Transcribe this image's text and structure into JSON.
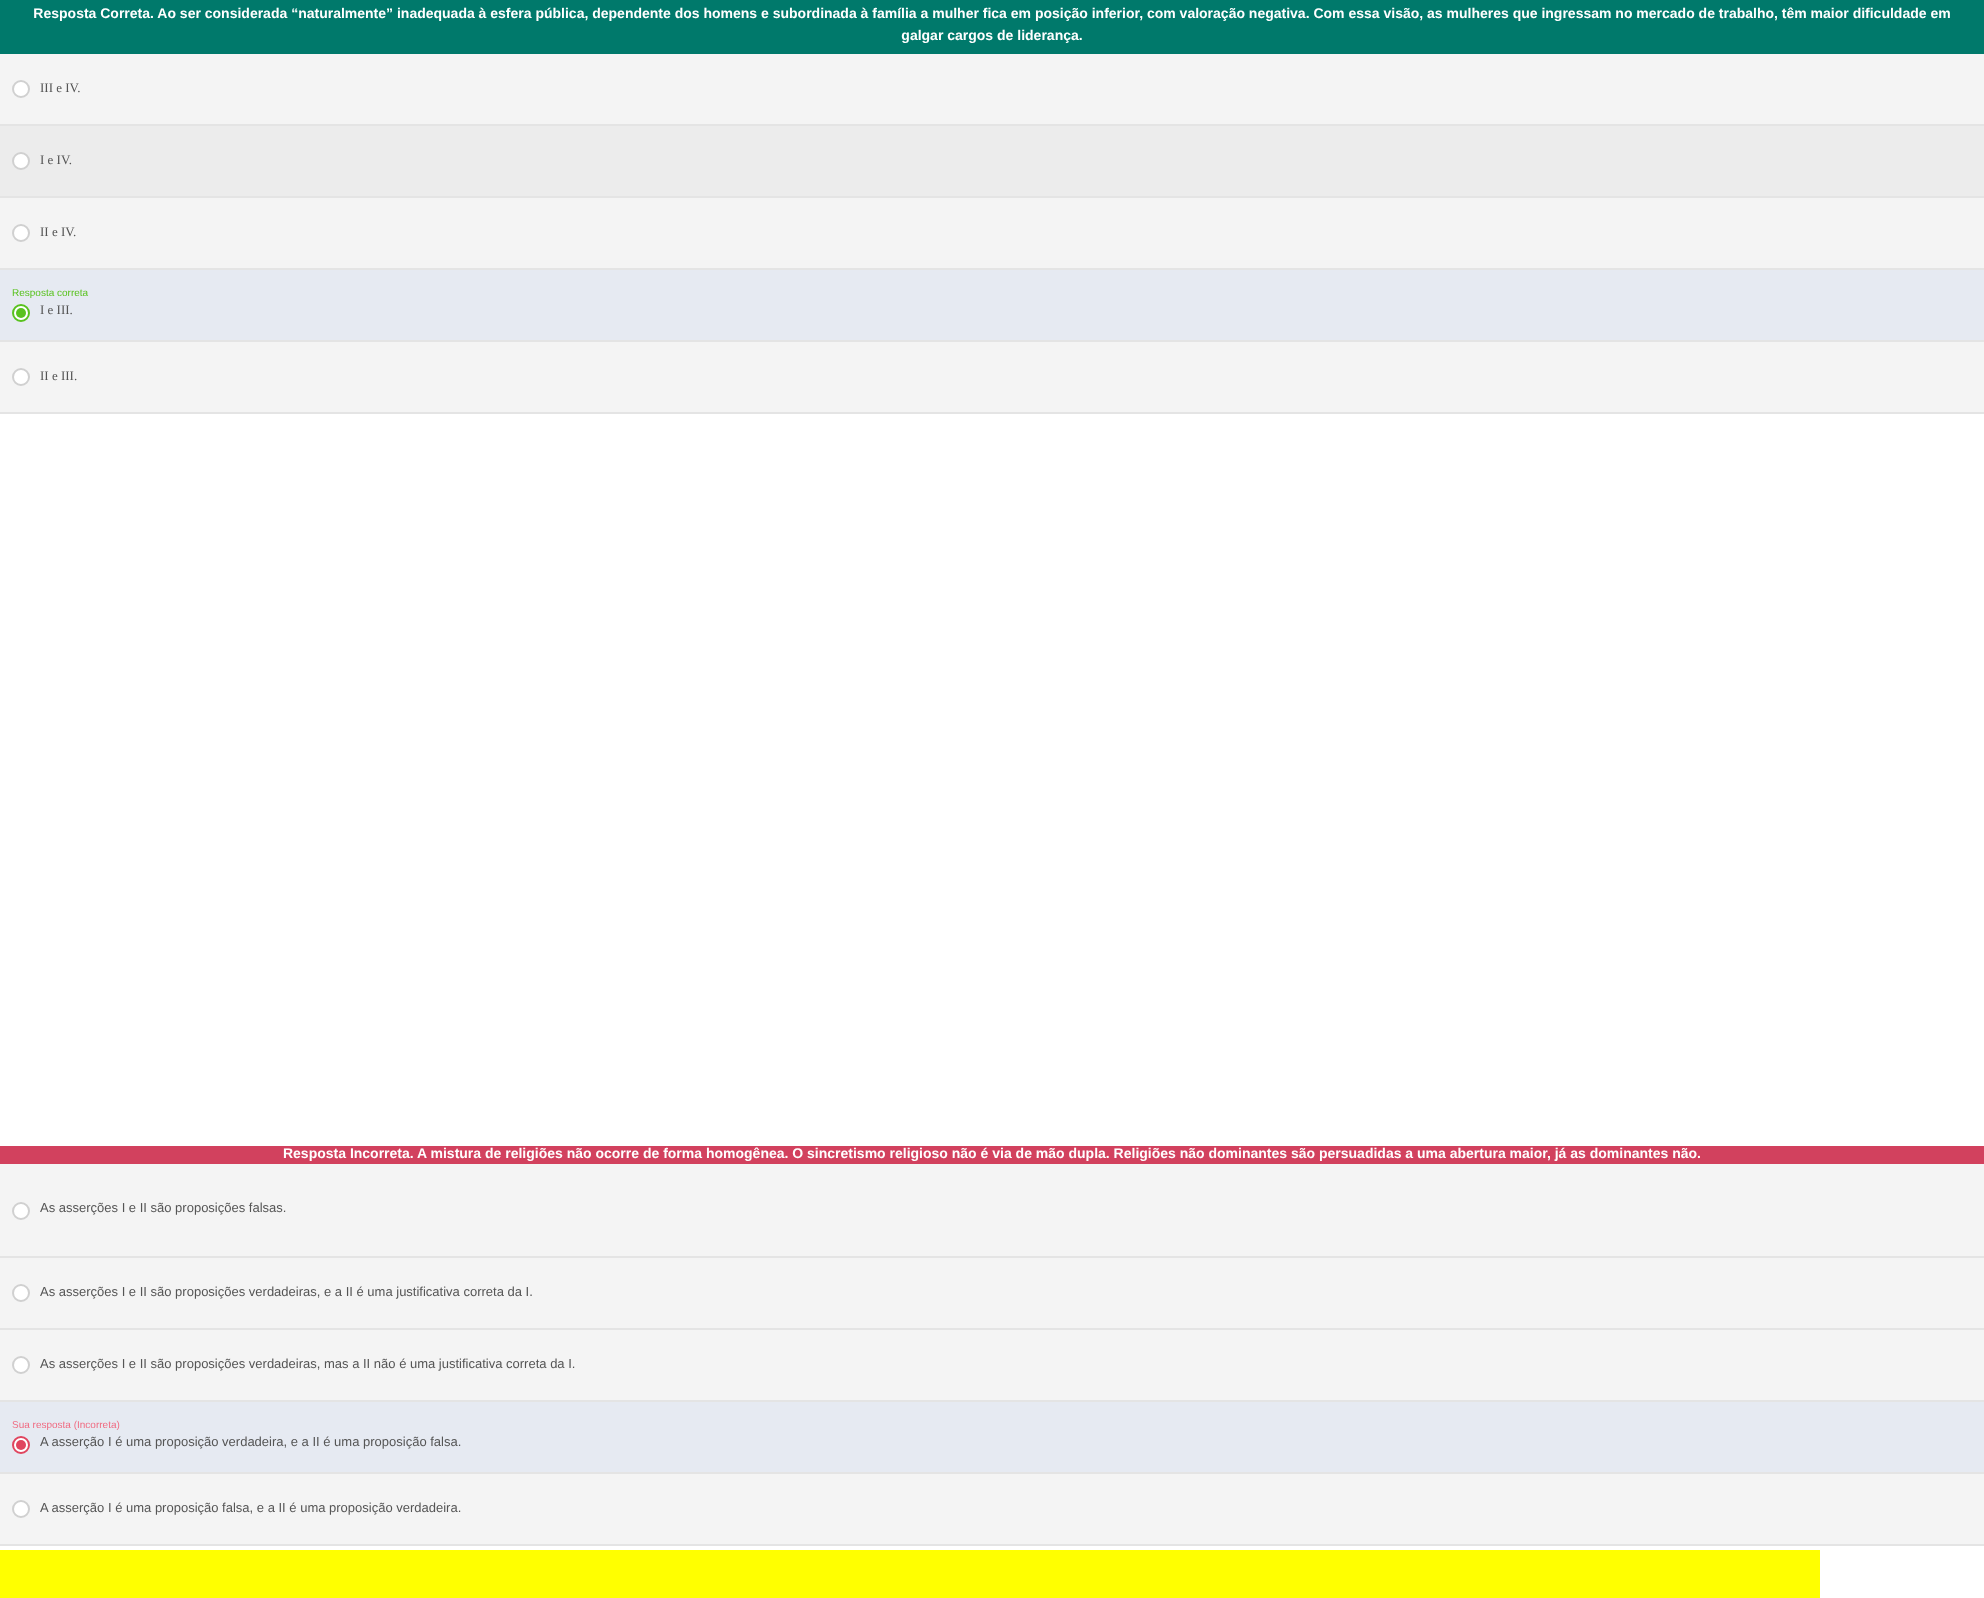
{
  "questions": [
    {
      "kind": "correct",
      "feedback": "Resposta Correta. Ao ser considerada “naturalmente” inadequada à esfera pública, dependente dos homens e subordinada à família a mulher fica em posição inferior, com valoração negativa. Com essa visão, as mulheres que ingressam no mercado de trabalho, têm maior dificuldade em galgar cargos de liderança.",
      "options": [
        {
          "text": "III e IV.",
          "selected": false
        },
        {
          "text": "I e IV.",
          "selected": false
        },
        {
          "text": "II e IV.",
          "selected": false
        },
        {
          "text": "I e III.",
          "selected": true,
          "label": "Resposta correta"
        },
        {
          "text": "II e III.",
          "selected": false
        }
      ]
    },
    {
      "kind": "incorrect",
      "feedback": "Resposta Incorreta. A mistura de religiões não ocorre de forma homogênea. O sincretismo religioso não é via de mão dupla. Religiões não dominantes são persuadidas a uma abertura maior, já as dominantes não.",
      "options": [
        {
          "text": "As asserções I e II são proposições falsas.",
          "selected": false
        },
        {
          "text": "As asserções I e II são proposições verdadeiras, e a II é uma justificativa correta da I.",
          "selected": false
        },
        {
          "text": "As asserções I e II são proposições verdadeiras, mas a II não é uma justificativa correta da I.",
          "selected": false
        },
        {
          "text": "A asserção I é uma proposição verdadeira, e a II é uma proposição falsa.",
          "selected": true,
          "label": "Sua resposta (Incorreta)"
        },
        {
          "text": "A asserção I é uma proposição falsa, e a II é uma proposição verdadeira.",
          "selected": false
        }
      ]
    }
  ]
}
